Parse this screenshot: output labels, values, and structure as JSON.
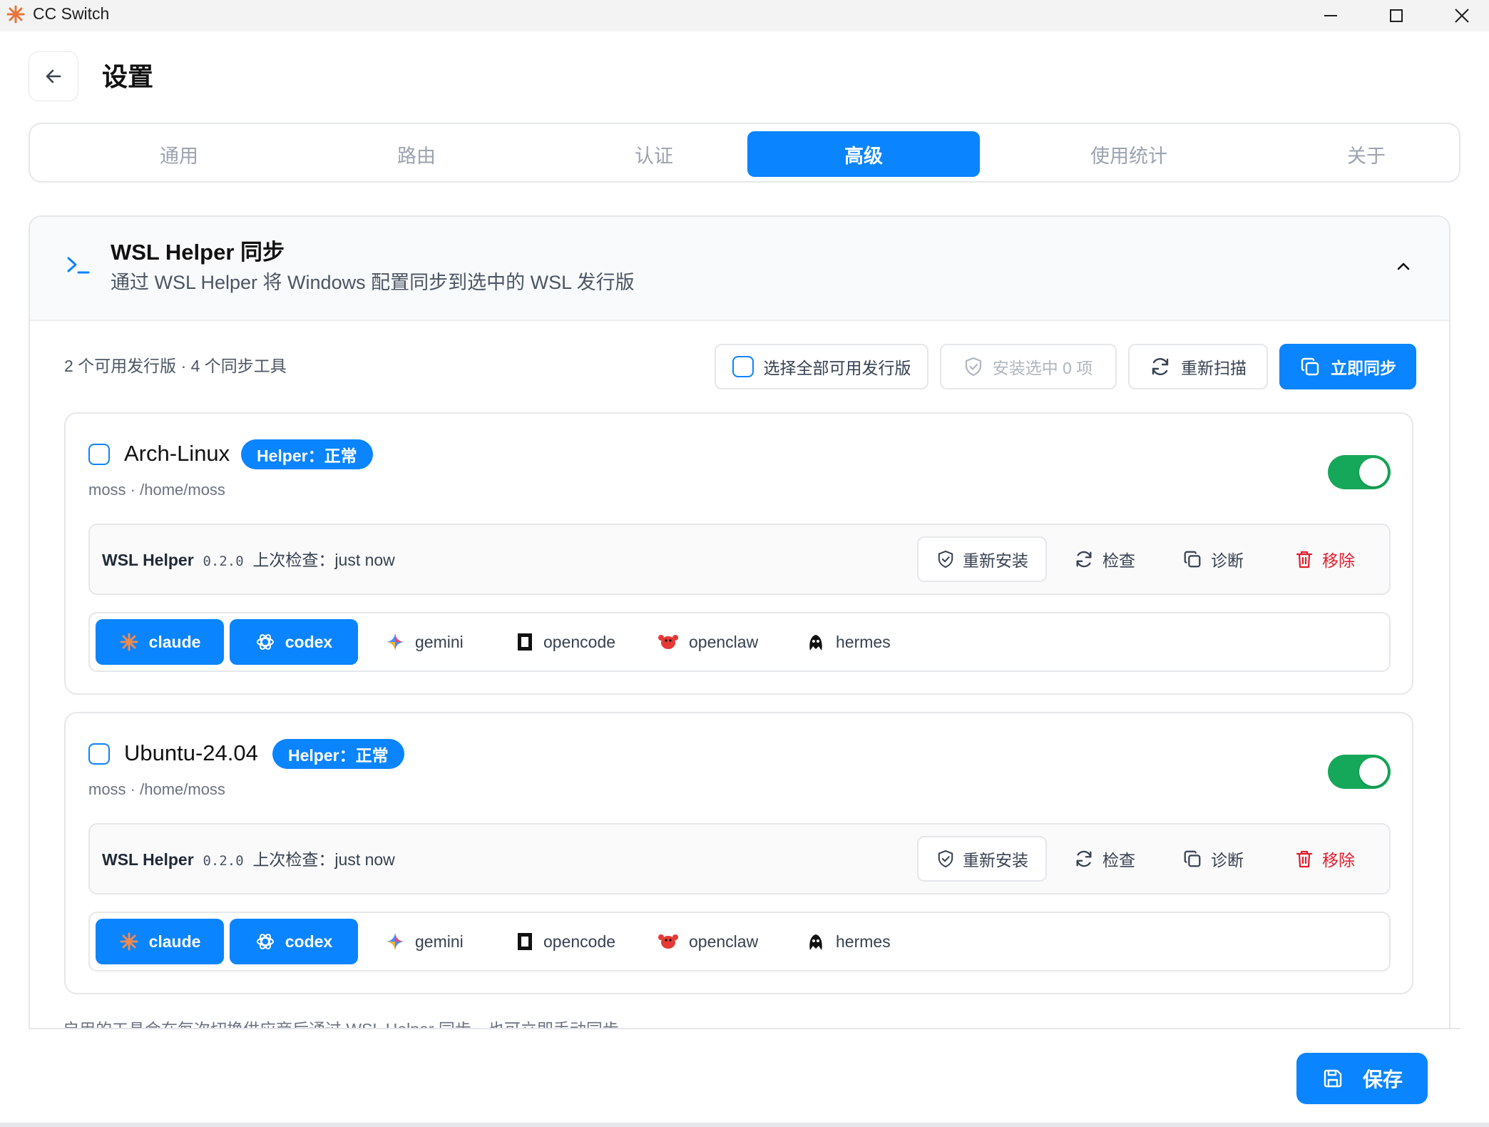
{
  "window": {
    "title": "CC Switch"
  },
  "header": {
    "title": "设置"
  },
  "tabs": [
    {
      "label": "通用",
      "active": false
    },
    {
      "label": "路由",
      "active": false
    },
    {
      "label": "认证",
      "active": false
    },
    {
      "label": "高级",
      "active": true
    },
    {
      "label": "使用统计",
      "active": false
    },
    {
      "label": "关于",
      "active": false
    }
  ],
  "section": {
    "title": "WSL Helper 同步",
    "subtitle": "通过 WSL Helper 将 Windows 配置同步到选中的 WSL 发行版",
    "summary": "2 个可用发行版 · 4 个同步工具",
    "actions": {
      "select_all": "选择全部可用发行版",
      "install_selected": "安装选中 0 项",
      "rescan": "重新扫描",
      "sync_now": "立即同步"
    },
    "distros": [
      {
        "name": "Arch-Linux",
        "badge": "Helper：正常",
        "subtitle": "moss · /home/moss",
        "enabled": true,
        "helper": {
          "label": "WSL Helper",
          "version": "0.2.0",
          "last_check": "上次检查：just now"
        },
        "helper_actions": {
          "reinstall": "重新安装",
          "check": "检查",
          "diagnose": "诊断",
          "remove": "移除"
        },
        "tools": [
          {
            "name": "claude",
            "on": true
          },
          {
            "name": "codex",
            "on": true
          },
          {
            "name": "gemini",
            "on": false
          },
          {
            "name": "opencode",
            "on": false
          },
          {
            "name": "openclaw",
            "on": false
          },
          {
            "name": "hermes",
            "on": false
          }
        ]
      },
      {
        "name": "Ubuntu-24.04",
        "badge": "Helper：正常",
        "subtitle": "moss · /home/moss",
        "enabled": true,
        "helper": {
          "label": "WSL Helper",
          "version": "0.2.0",
          "last_check": "上次检查：just now"
        },
        "helper_actions": {
          "reinstall": "重新安装",
          "check": "检查",
          "diagnose": "诊断",
          "remove": "移除"
        },
        "tools": [
          {
            "name": "claude",
            "on": true
          },
          {
            "name": "codex",
            "on": true
          },
          {
            "name": "gemini",
            "on": false
          },
          {
            "name": "opencode",
            "on": false
          },
          {
            "name": "openclaw",
            "on": false
          },
          {
            "name": "hermes",
            "on": false
          }
        ]
      }
    ],
    "footer_note": "启用的工具会在每次切换供应商后通过 WSL Helper 同步，也可立即手动同步"
  },
  "save_button": "保存",
  "colors": {
    "accent": "#0a84ff",
    "toggle_on": "#16a85a",
    "danger": "#e11d2e"
  }
}
